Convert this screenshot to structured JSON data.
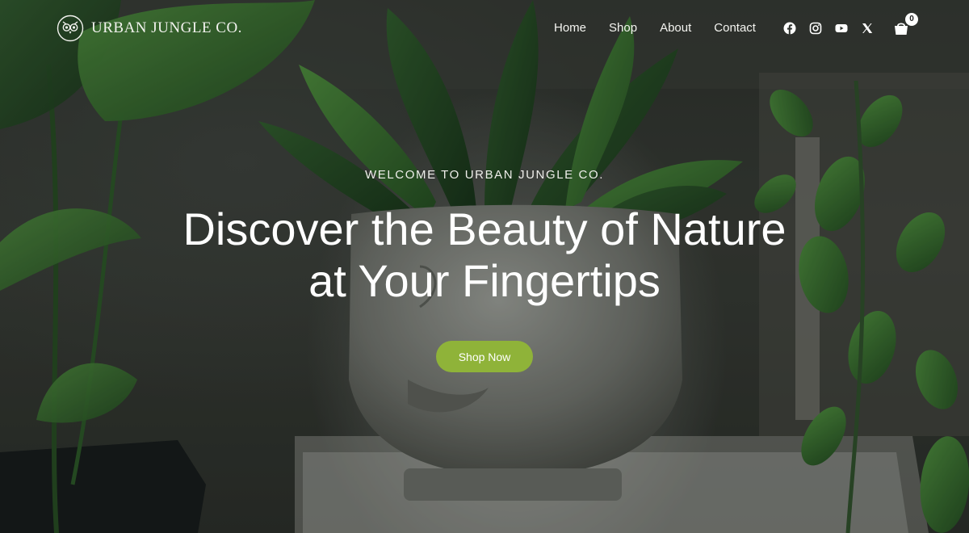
{
  "brand": {
    "name": "URBAN JUNGLE CO."
  },
  "nav": {
    "links": [
      "Home",
      "Shop",
      "About",
      "Contact"
    ],
    "socials": [
      "facebook-icon",
      "instagram-icon",
      "youtube-icon",
      "x-icon"
    ],
    "cart_count": "0"
  },
  "hero": {
    "eyebrow": "WELCOME TO URBAN JUNGLE CO.",
    "headline": "Discover the Beauty of Nature at Your Fingertips",
    "cta_label": "Shop Now"
  },
  "colors": {
    "accent": "#8fb339",
    "text": "#ffffff"
  }
}
